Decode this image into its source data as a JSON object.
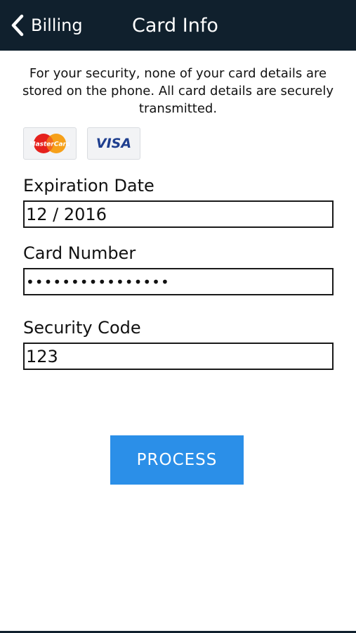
{
  "navbar": {
    "back_label": "Billing",
    "back_icon": "chevron-left-icon",
    "title": "Card Info"
  },
  "security_note": "For your security, none of your card details are stored on the phone. All card details are securely transmitted.",
  "card_logos": {
    "mastercard": {
      "text": "MasterCard",
      "icon": "mastercard-logo-icon"
    },
    "visa": {
      "text": "VISA",
      "icon": "visa-logo-icon"
    }
  },
  "fields": {
    "expiration": {
      "label": "Expiration Date",
      "value": "12 / 2016"
    },
    "card_number": {
      "label": "Card Number",
      "value": "0000000000000000"
    },
    "security_code": {
      "label": "Security Code",
      "value": "123"
    }
  },
  "process_button": {
    "label": "PROCESS"
  },
  "colors": {
    "navbar_bg": "#10202d",
    "button_bg": "#2b8fe8",
    "mastercard_red": "#e5211d",
    "mastercard_orange": "#f6a019",
    "visa_blue": "#1f3f8f"
  }
}
